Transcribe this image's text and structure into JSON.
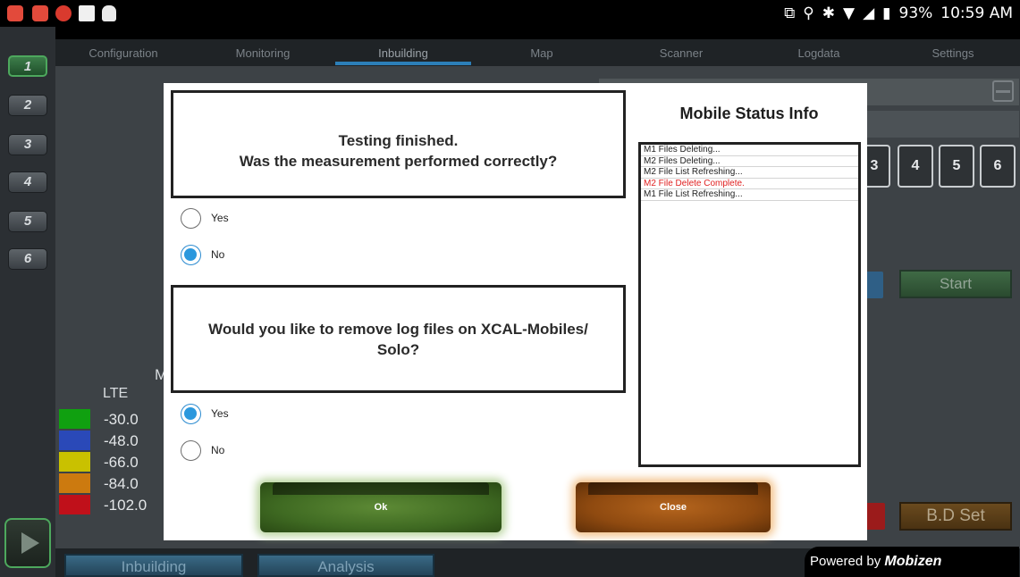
{
  "status_bar": {
    "battery": "93%",
    "time": "10:59 AM"
  },
  "rail": {
    "buttons": [
      "1",
      "2",
      "3",
      "4",
      "5",
      "6"
    ]
  },
  "tabs": [
    {
      "label": "Configuration"
    },
    {
      "label": "Monitoring"
    },
    {
      "label": "Inbuilding"
    },
    {
      "label": "Map"
    },
    {
      "label": "Scanner"
    },
    {
      "label": "Logdata"
    },
    {
      "label": "Settings"
    }
  ],
  "background": {
    "number_buttons": [
      "3",
      "4",
      "5",
      "6"
    ],
    "start_label": "Start",
    "bdset_label": "B.D Set",
    "m_letter": "M",
    "legend": {
      "title": "LTE",
      "items": [
        {
          "value": "-30.0",
          "color": "#10a010"
        },
        {
          "value": "-48.0",
          "color": "#2a49b8"
        },
        {
          "value": "-66.0",
          "color": "#c9c100"
        },
        {
          "value": "-84.0",
          "color": "#cc7a0f"
        },
        {
          "value": "-102.0",
          "color": "#c0101a"
        }
      ]
    }
  },
  "bottom": {
    "tabs": [
      "Inbuilding",
      "Analysis"
    ],
    "powered_by": "Powered by",
    "brand": "Mobizen"
  },
  "dialog": {
    "q1": {
      "line1": "Testing finished.",
      "line2": "Was the measurement performed correctly?"
    },
    "q1_options": [
      {
        "label": "Yes",
        "selected": false
      },
      {
        "label": "No",
        "selected": true
      }
    ],
    "q2": "Would you like to remove log files on XCAL-Mobiles/ Solo?",
    "q2_options": [
      {
        "label": "Yes",
        "selected": true
      },
      {
        "label": "No",
        "selected": false
      }
    ],
    "ok_label": "Ok",
    "close_label": "Close",
    "status_title": "Mobile Status Info",
    "status_items": [
      {
        "text": "M1 Files Deleting...",
        "color": "#222222"
      },
      {
        "text": "M2 Files Deleting...",
        "color": "#222222"
      },
      {
        "text": "M2 File List Refreshing...",
        "color": "#222222"
      },
      {
        "text": "M2 File Delete Complete.",
        "color": "#e02020"
      },
      {
        "text": "M1 File List Refreshing...",
        "color": "#222222"
      }
    ]
  }
}
